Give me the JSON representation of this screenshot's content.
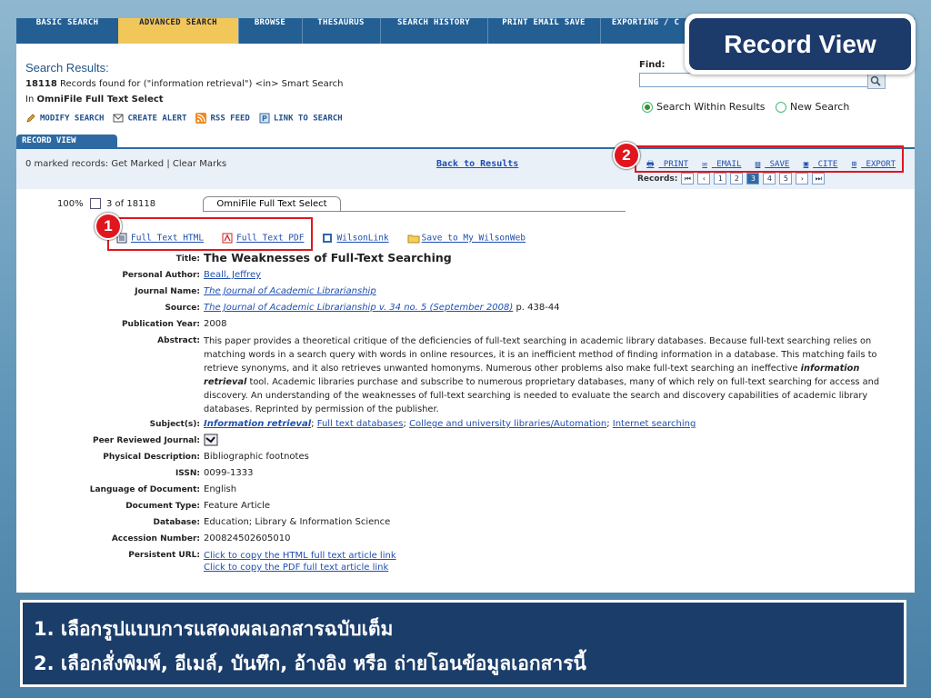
{
  "nav": {
    "tabs": [
      "BASIC SEARCH",
      "ADVANCED SEARCH",
      "BROWSE",
      "THESAURUS",
      "SEARCH HISTORY",
      "PRINT EMAIL SAVE",
      "EXPORTING / C"
    ],
    "active_tab": "ADVANCED SEARCH"
  },
  "callout": {
    "title": "Record View"
  },
  "results": {
    "heading": "Search Results:",
    "count": "18118",
    "summary": "Records found for (\"information retrieval\") <in> Smart Search",
    "in_label": "In",
    "database": "OmniFile Full Text Select"
  },
  "actions": [
    "MODIFY SEARCH",
    "CREATE ALERT",
    "RSS FEED",
    "LINK TO SEARCH"
  ],
  "find": {
    "label": "Find:",
    "value": "",
    "options": [
      "Search Within Results",
      "New Search"
    ],
    "selected": "Search Within Results"
  },
  "record_bar": {
    "tab": "RECORD VIEW",
    "marked": "0 marked records: Get Marked | Clear Marks",
    "back": "Back to Results",
    "tools": [
      "PRINT",
      "EMAIL",
      "SAVE",
      "CITE",
      "EXPORT"
    ],
    "records_label": "Records:",
    "pages": [
      "1",
      "2",
      "3",
      "4",
      "5"
    ],
    "current_page": "3"
  },
  "record": {
    "zoom": "100%",
    "position": "3 of 18118",
    "db_tab": "OmniFile Full Text Select",
    "fulltext_links": [
      "Full Text HTML",
      "Full Text PDF",
      "WilsonLink",
      "Save to My WilsonWeb"
    ],
    "fields": [
      {
        "label": "Title:",
        "value": "The Weaknesses of Full-Text Searching"
      },
      {
        "label": "Personal Author:",
        "value": "Beall, Jeffrey"
      },
      {
        "label": "Journal Name:",
        "value": "The Journal of Academic Librarianship"
      },
      {
        "label": "Source:",
        "value": "The Journal of Academic Librarianship v. 34 no. 5 (September 2008)",
        "suffix": " p. 438-44"
      },
      {
        "label": "Publication Year:",
        "value": "2008"
      },
      {
        "label": "Abstract:",
        "value": "This paper provides a theoretical critique of the deficiencies of full-text searching in academic library databases. Because full-text searching relies on matching words in a search query with words in online resources, it is an inefficient method of finding information in a database. This matching fails to retrieve synonyms, and it also retrieves unwanted homonyms. Numerous other problems also make full-text searching an ineffective information retrieval tool. Academic libraries purchase and subscribe to numerous proprietary databases, many of which rely on full-text searching for access and discovery. An understanding of the weaknesses of full-text searching is needed to evaluate the search and discovery capabilities of academic library databases. Reprinted by permission of the publisher."
      },
      {
        "label": "Subject(s):",
        "value": [
          "Information retrieval",
          "Full text databases",
          "College and university libraries/Automation",
          "Internet searching"
        ]
      },
      {
        "label": "Peer Reviewed Journal:",
        "value": ""
      },
      {
        "label": "Physical Description:",
        "value": "Bibliographic footnotes"
      },
      {
        "label": "ISSN:",
        "value": "0099-1333"
      },
      {
        "label": "Language of Document:",
        "value": "English"
      },
      {
        "label": "Document Type:",
        "value": "Feature Article"
      },
      {
        "label": "Database:",
        "value": "Education; Library & Information Science"
      },
      {
        "label": "Accession Number:",
        "value": "200824502605010"
      },
      {
        "label": "Persistent URL:",
        "value": [
          "Click to copy the HTML full text article link",
          "Click to copy the PDF full text article link"
        ]
      }
    ]
  },
  "badges": [
    "1",
    "2"
  ],
  "caption": {
    "line1": "1. เลือกรูปแบบการแสดงผลเอกสารฉบับเต็ม",
    "line2": "2. เลือกสั่งพิมพ์, อีเมล์, บันทึก, อ้างอิง หรือ ถ่ายโอนข้อมูลเอกสารนี้"
  },
  "colors": {
    "nav_bg": "#245f94",
    "active_tab": "#f2c75a",
    "highlight": "#e0161e",
    "caption_bg": "#1b3d6a",
    "link": "#1f4fb0"
  }
}
